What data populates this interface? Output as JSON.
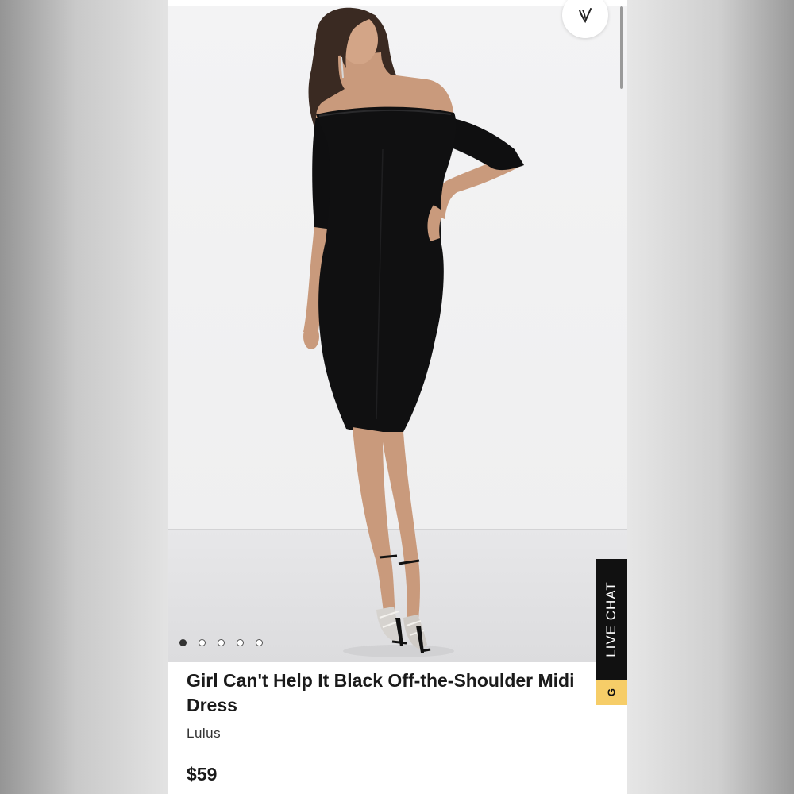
{
  "product": {
    "title": "Girl Can't Help It Black Off-the-Shoulder Midi Dress",
    "brand": "Lulus",
    "price": "$59"
  },
  "gallery": {
    "image_count": 5,
    "active_index": 0
  },
  "chat": {
    "label": "LIVE CHAT",
    "tab_letter": "G"
  },
  "icons": {
    "favorite": "heart-logo-icon"
  },
  "colors": {
    "chat_background": "#111111",
    "chat_accent": "#f6cd68",
    "text": "#1a1a1a"
  }
}
